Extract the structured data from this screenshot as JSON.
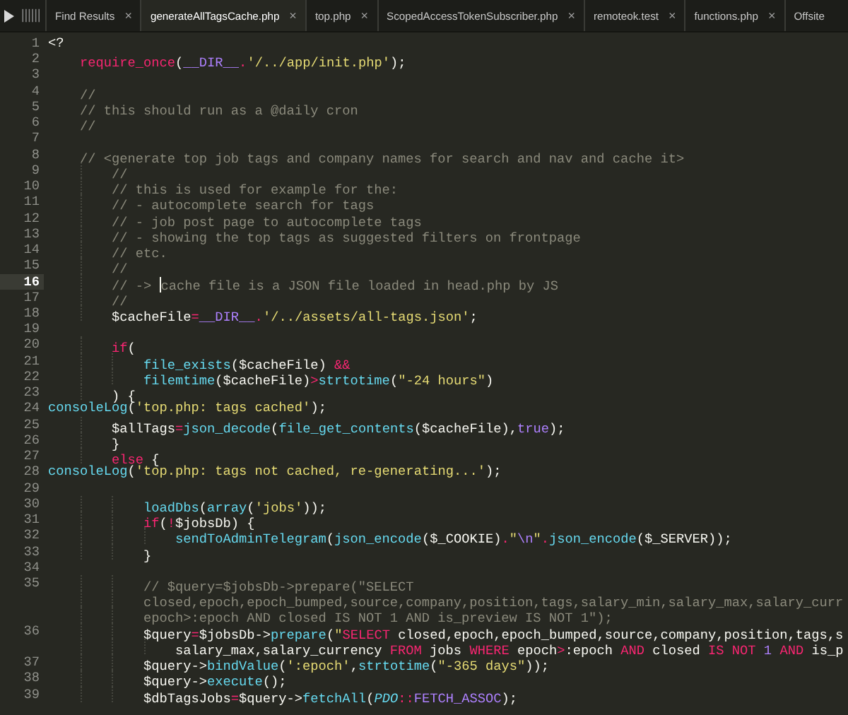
{
  "tabs": [
    {
      "label": "Find Results",
      "close": "×",
      "selected": false
    },
    {
      "label": "generateAllTagsCache.php",
      "close": "×",
      "selected": true
    },
    {
      "label": "top.php",
      "close": "×",
      "selected": false
    },
    {
      "label": "ScopedAccessTokenSubscriber.php",
      "close": "×",
      "selected": false
    },
    {
      "label": "remoteok.test",
      "close": "×",
      "selected": false
    },
    {
      "label": "functions.php",
      "close": "×",
      "selected": false
    },
    {
      "label": "Offsite",
      "selected": false
    }
  ],
  "lines": [
    {
      "number": "1",
      "current": false,
      "rows": [
        {
          "tokens": [
            {
              "kind": "plain",
              "text": "<?"
            }
          ]
        }
      ]
    },
    {
      "number": "2",
      "current": false,
      "rows": [
        {
          "indent": "\t",
          "tokens": [
            {
              "kind": "keyword",
              "text": "require_once"
            },
            {
              "kind": "plain",
              "text": "("
            },
            {
              "kind": "constant",
              "text": "__DIR__"
            },
            {
              "kind": "keyword",
              "text": "."
            },
            {
              "kind": "string",
              "text": "'/../app/init.php'"
            },
            {
              "kind": "plain",
              "text": ");"
            }
          ]
        }
      ]
    },
    {
      "number": "3",
      "current": false
    },
    {
      "number": "4",
      "current": false,
      "rows": [
        {
          "indent": "\t",
          "tokens": [
            {
              "kind": "comment",
              "text": "//"
            }
          ]
        }
      ]
    },
    {
      "number": "5",
      "current": false,
      "rows": [
        {
          "indent": "\t",
          "tokens": [
            {
              "kind": "comment",
              "text": "// this should run as a @daily cron"
            }
          ]
        }
      ]
    },
    {
      "number": "6",
      "current": false,
      "rows": [
        {
          "indent": "\t",
          "tokens": [
            {
              "kind": "comment",
              "text": "//"
            }
          ]
        }
      ]
    },
    {
      "number": "7",
      "current": false
    },
    {
      "number": "8",
      "current": false,
      "rows": [
        {
          "indent": "\t",
          "tokens": [
            {
              "kind": "comment",
              "text": "// <generate top job tags and company names for search and nav and cache it>"
            }
          ]
        }
      ]
    },
    {
      "number": "9",
      "current": false,
      "rows": [
        {
          "indent": "\t\t",
          "tokens": [
            {
              "kind": "comment",
              "text": "//"
            }
          ]
        }
      ]
    },
    {
      "number": "10",
      "current": false,
      "rows": [
        {
          "indent": "\t\t",
          "tokens": [
            {
              "kind": "comment",
              "text": "// this is used for example for the:"
            }
          ]
        }
      ]
    },
    {
      "number": "11",
      "current": false,
      "rows": [
        {
          "indent": "\t\t",
          "tokens": [
            {
              "kind": "comment",
              "text": "// - autocomplete search for tags"
            }
          ]
        }
      ]
    },
    {
      "number": "12",
      "current": false,
      "rows": [
        {
          "indent": "\t\t",
          "tokens": [
            {
              "kind": "comment",
              "text": "// - job post page to autocomplete tags"
            }
          ]
        }
      ]
    },
    {
      "number": "13",
      "current": false,
      "rows": [
        {
          "indent": "\t\t",
          "tokens": [
            {
              "kind": "comment",
              "text": "// - showing the top tags as suggested filters on frontpage"
            }
          ]
        }
      ]
    },
    {
      "number": "14",
      "current": false,
      "rows": [
        {
          "indent": "\t\t",
          "tokens": [
            {
              "kind": "comment",
              "text": "// etc."
            }
          ]
        }
      ]
    },
    {
      "number": "15",
      "current": false,
      "rows": [
        {
          "indent": "\t\t",
          "tokens": [
            {
              "kind": "comment",
              "text": "//"
            }
          ]
        }
      ]
    },
    {
      "number": "16",
      "current": true,
      "rows": [
        {
          "indent": "\t\t",
          "tokens": [
            {
              "kind": "comment",
              "text": "// -> "
            },
            {
              "kind": "caret"
            },
            {
              "kind": "comment",
              "text": "cache file is a JSON file loaded in head.php by JS"
            }
          ]
        }
      ]
    },
    {
      "number": "17",
      "current": false,
      "rows": [
        {
          "indent": "\t\t",
          "tokens": [
            {
              "kind": "comment",
              "text": "//"
            }
          ]
        }
      ]
    },
    {
      "number": "18",
      "current": false,
      "rows": [
        {
          "indent": "\t\t",
          "tokens": [
            {
              "kind": "plain",
              "text": "$cacheFile"
            },
            {
              "kind": "keyword",
              "text": "="
            },
            {
              "kind": "constant",
              "text": "__DIR__"
            },
            {
              "kind": "keyword",
              "text": "."
            },
            {
              "kind": "string",
              "text": "'/../assets/all-tags.json'"
            },
            {
              "kind": "plain",
              "text": ";"
            }
          ]
        }
      ]
    },
    {
      "number": "19",
      "current": false
    },
    {
      "number": "20",
      "current": false,
      "rows": [
        {
          "indent": "\t\t",
          "tokens": [
            {
              "kind": "keyword",
              "text": "if"
            },
            {
              "kind": "plain",
              "text": "("
            }
          ]
        }
      ]
    },
    {
      "number": "21",
      "current": false,
      "rows": [
        {
          "indent": "\t\t\t",
          "tokens": [
            {
              "kind": "func",
              "text": "file_exists"
            },
            {
              "kind": "plain",
              "text": "($cacheFile) "
            },
            {
              "kind": "keyword",
              "text": "&&"
            }
          ]
        }
      ]
    },
    {
      "number": "22",
      "current": false,
      "rows": [
        {
          "indent": "\t\t\t",
          "tokens": [
            {
              "kind": "func",
              "text": "filemtime"
            },
            {
              "kind": "plain",
              "text": "($cacheFile)"
            },
            {
              "kind": "keyword",
              "text": ">"
            },
            {
              "kind": "func",
              "text": "strtotime"
            },
            {
              "kind": "plain",
              "text": "("
            },
            {
              "kind": "string",
              "text": "\"-24 hours\""
            },
            {
              "kind": "plain",
              "text": ")"
            }
          ]
        }
      ]
    },
    {
      "number": "23",
      "current": false,
      "rows": [
        {
          "indent": "\t\t",
          "tokens": [
            {
              "kind": "plain",
              "text": ") {"
            }
          ]
        }
      ]
    },
    {
      "number": "24",
      "current": false,
      "rows": [
        {
          "tokens": [
            {
              "kind": "func",
              "text": "consoleLog"
            },
            {
              "kind": "plain",
              "text": "("
            },
            {
              "kind": "string",
              "text": "'top.php: tags cached'"
            },
            {
              "kind": "plain",
              "text": ");"
            }
          ]
        }
      ]
    },
    {
      "number": "25",
      "current": false,
      "rows": [
        {
          "indent": "\t\t",
          "tokens": [
            {
              "kind": "plain",
              "text": "$allTags"
            },
            {
              "kind": "keyword",
              "text": "="
            },
            {
              "kind": "func",
              "text": "json_decode"
            },
            {
              "kind": "plain",
              "text": "("
            },
            {
              "kind": "func",
              "text": "file_get_contents"
            },
            {
              "kind": "plain",
              "text": "($cacheFile),"
            },
            {
              "kind": "constant",
              "text": "true"
            },
            {
              "kind": "plain",
              "text": ");"
            }
          ]
        }
      ]
    },
    {
      "number": "26",
      "current": false,
      "rows": [
        {
          "indent": "\t\t",
          "tokens": [
            {
              "kind": "plain",
              "text": "}"
            }
          ]
        }
      ]
    },
    {
      "number": "27",
      "current": false,
      "rows": [
        {
          "indent": "\t\t",
          "tokens": [
            {
              "kind": "keyword",
              "text": "else"
            },
            {
              "kind": "plain",
              "text": " {"
            }
          ]
        }
      ]
    },
    {
      "number": "28",
      "current": false,
      "rows": [
        {
          "tokens": [
            {
              "kind": "func",
              "text": "consoleLog"
            },
            {
              "kind": "plain",
              "text": "("
            },
            {
              "kind": "string",
              "text": "'top.php: tags not cached, re-generating...'"
            },
            {
              "kind": "plain",
              "text": ");"
            }
          ]
        }
      ]
    },
    {
      "number": "29",
      "current": false
    },
    {
      "number": "30",
      "current": false,
      "rows": [
        {
          "indent": "\t\t\t",
          "tokens": [
            {
              "kind": "func",
              "text": "loadDbs"
            },
            {
              "kind": "plain",
              "text": "("
            },
            {
              "kind": "func",
              "text": "array"
            },
            {
              "kind": "plain",
              "text": "("
            },
            {
              "kind": "string",
              "text": "'jobs'"
            },
            {
              "kind": "plain",
              "text": "));"
            }
          ]
        }
      ]
    },
    {
      "number": "31",
      "current": false,
      "rows": [
        {
          "indent": "\t\t\t",
          "tokens": [
            {
              "kind": "keyword",
              "text": "if"
            },
            {
              "kind": "plain",
              "text": "("
            },
            {
              "kind": "keyword",
              "text": "!"
            },
            {
              "kind": "plain",
              "text": "$jobsDb) {"
            }
          ]
        }
      ]
    },
    {
      "number": "32",
      "current": false,
      "rows": [
        {
          "indent": "\t\t\t\t",
          "tokens": [
            {
              "kind": "func",
              "text": "sendToAdminTelegram"
            },
            {
              "kind": "plain",
              "text": "("
            },
            {
              "kind": "func",
              "text": "json_encode"
            },
            {
              "kind": "plain",
              "text": "($_COOKIE)"
            },
            {
              "kind": "keyword",
              "text": "."
            },
            {
              "kind": "string",
              "text": "\""
            },
            {
              "kind": "constant",
              "text": "\\n"
            },
            {
              "kind": "string",
              "text": "\""
            },
            {
              "kind": "keyword",
              "text": "."
            },
            {
              "kind": "func",
              "text": "json_encode"
            },
            {
              "kind": "plain",
              "text": "($_SERVER));"
            }
          ]
        }
      ]
    },
    {
      "number": "33",
      "current": false,
      "rows": [
        {
          "indent": "\t\t\t",
          "tokens": [
            {
              "kind": "plain",
              "text": "}"
            }
          ]
        }
      ]
    },
    {
      "number": "34",
      "current": false
    },
    {
      "number": "35",
      "current": false,
      "rows": [
        {
          "indent": "\t\t\t",
          "tokens": [
            {
              "kind": "comment",
              "text": "// $query=$jobsDb->prepare(\"SELECT"
            }
          ]
        },
        {
          "indent": "\t\t\t",
          "tokens": [
            {
              "kind": "comment",
              "text": "closed,epoch,epoch_bumped,source,company,position,tags,salary_min,salary_max,salary_curr"
            }
          ]
        },
        {
          "indent": "\t\t\t",
          "tokens": [
            {
              "kind": "comment",
              "text": "epoch>:epoch AND closed IS NOT 1 AND is_preview IS NOT 1\");"
            }
          ]
        }
      ]
    },
    {
      "number": "36",
      "current": false,
      "rows": [
        {
          "indent": "\t\t\t",
          "tokens": [
            {
              "kind": "plain",
              "text": "$query"
            },
            {
              "kind": "keyword",
              "text": "="
            },
            {
              "kind": "plain",
              "text": "$jobsDb->"
            },
            {
              "kind": "func",
              "text": "prepare"
            },
            {
              "kind": "plain",
              "text": "("
            },
            {
              "kind": "string",
              "text": "\""
            },
            {
              "kind": "keyword",
              "text": "SELECT"
            },
            {
              "kind": "plain",
              "text": " closed,epoch,epoch_bumped,source,company,position,tags,s"
            }
          ]
        },
        {
          "indent": "\t\t\t\t",
          "tokens": [
            {
              "kind": "plain",
              "text": "salary_max,salary_currency "
            },
            {
              "kind": "keyword",
              "text": "FROM"
            },
            {
              "kind": "plain",
              "text": " jobs "
            },
            {
              "kind": "keyword",
              "text": "WHERE"
            },
            {
              "kind": "plain",
              "text": " epoch"
            },
            {
              "kind": "keyword",
              "text": ">"
            },
            {
              "kind": "plain",
              "text": ":epoch "
            },
            {
              "kind": "keyword",
              "text": "AND"
            },
            {
              "kind": "plain",
              "text": " closed "
            },
            {
              "kind": "keyword",
              "text": "IS NOT "
            },
            {
              "kind": "constant",
              "text": "1"
            },
            {
              "kind": "keyword",
              "text": " AND"
            },
            {
              "kind": "plain",
              "text": " is_p"
            }
          ]
        }
      ]
    },
    {
      "number": "37",
      "current": false,
      "rows": [
        {
          "indent": "\t\t\t",
          "tokens": [
            {
              "kind": "plain",
              "text": "$query->"
            },
            {
              "kind": "func",
              "text": "bindValue"
            },
            {
              "kind": "plain",
              "text": "("
            },
            {
              "kind": "string",
              "text": "':epoch'"
            },
            {
              "kind": "plain",
              "text": ","
            },
            {
              "kind": "func",
              "text": "strtotime"
            },
            {
              "kind": "plain",
              "text": "("
            },
            {
              "kind": "string",
              "text": "\"-365 days\""
            },
            {
              "kind": "plain",
              "text": "));"
            }
          ]
        }
      ]
    },
    {
      "number": "38",
      "current": false,
      "rows": [
        {
          "indent": "\t\t\t",
          "tokens": [
            {
              "kind": "plain",
              "text": "$query->"
            },
            {
              "kind": "func",
              "text": "execute"
            },
            {
              "kind": "plain",
              "text": "();"
            }
          ]
        }
      ]
    },
    {
      "number": "39",
      "current": false,
      "rows": [
        {
          "indent": "\t\t\t",
          "tokens": [
            {
              "kind": "plain",
              "text": "$dbTagsJobs"
            },
            {
              "kind": "keyword",
              "text": "="
            },
            {
              "kind": "plain",
              "text": "$query->"
            },
            {
              "kind": "func",
              "text": "fetchAll"
            },
            {
              "kind": "plain",
              "text": "("
            },
            {
              "kind": "class",
              "text": "PDO"
            },
            {
              "kind": "keyword",
              "text": "::"
            },
            {
              "kind": "constant",
              "text": "FETCH_ASSOC"
            },
            {
              "kind": "plain",
              "text": ");"
            }
          ]
        }
      ]
    }
  ]
}
